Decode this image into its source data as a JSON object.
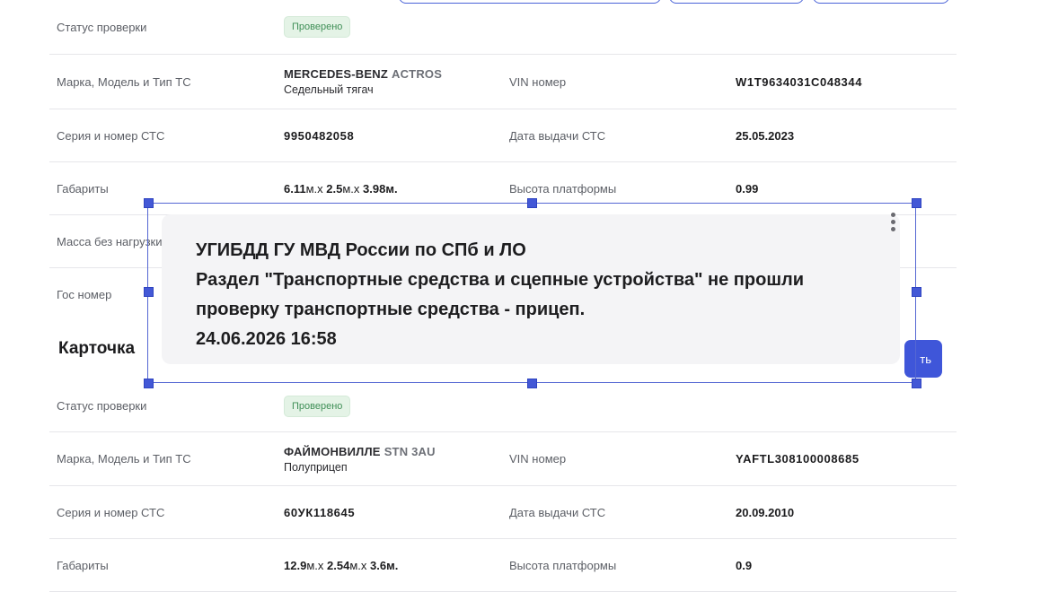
{
  "card1": {
    "status_label": "Статус проверки",
    "status_badge": "Проверено",
    "make_label": "Марка, Модель и Тип ТС",
    "brand": "MERCEDES-BENZ",
    "model": "ACTROS",
    "type": "Седельный тягач",
    "vin_label": "VIN номер",
    "vin": "W1T9634031C048344",
    "sts_label": "Серия и номер СТС",
    "sts": "9950482058",
    "sts_date_label": "Дата выдачи СТС",
    "sts_date": "25.05.2023",
    "dims_label": "Габариты",
    "dim1": "6.11",
    "dim2": "2.5",
    "dim3": "3.98",
    "platform_label": "Высота платформы",
    "platform": "0.99",
    "mass_label": "Масса без нагрузки",
    "plate_label": "Гос номер"
  },
  "card2": {
    "title": "Карточка",
    "status_label": "Статус проверки",
    "status_badge": "Проверено",
    "make_label": "Марка, Модель и Тип ТС",
    "brand": "ФАЙМОНВИЛЛЕ",
    "model": "STN 3AU",
    "type": "Полуприцеп",
    "vin_label": "VIN номер",
    "vin": "YAFTL308100008685",
    "sts_label": "Серия и номер СТС",
    "sts": "60УК118645",
    "sts_date_label": "Дата выдачи СТС",
    "sts_date": "20.09.2010",
    "dims_label": "Габариты",
    "dim1": "12.9",
    "dim2": "2.54",
    "dim3": "3.6",
    "platform_label": "Высота платформы",
    "platform": "0.9",
    "action_button_partial": "ть"
  },
  "units": {
    "m_x": "м.x",
    "m": "м."
  },
  "tooltip": {
    "line1": "УГИБДД ГУ МВД России по СПб и ЛО",
    "line2": "Раздел \"Транспортные средства и сцепные устройства\" не прошли",
    "line3": "проверку транспортные средства - прицеп.",
    "line4": "24.06.2026 16:58"
  },
  "colors": {
    "accent": "#3f56d9",
    "badge_bg": "#e4f3e6",
    "badge_text": "#3f8f57"
  },
  "icons": {
    "tooltip_menu": "kebab-menu-icon"
  }
}
